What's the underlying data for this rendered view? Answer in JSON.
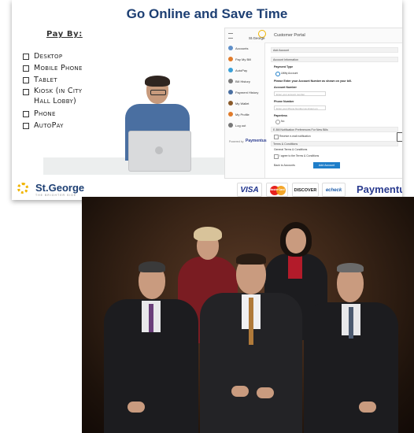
{
  "slide": {
    "title": "Go Online and Save Time",
    "pay_by_label": "Pay By:",
    "pay_methods": [
      "Desktop",
      "Mobile Phone",
      "Tablet",
      "Kiosk (in City",
      "Hall Lobby)",
      "Phone",
      "AutoPay"
    ],
    "portal": {
      "logo_text": "St.George",
      "header": "Customer Portal",
      "sidebar": [
        {
          "label": "Accounts",
          "icon": "accounts-icon",
          "color": "#5f8fc8"
        },
        {
          "label": "Pay My Bill",
          "icon": "pay-bill-icon",
          "color": "#e07b2a"
        },
        {
          "label": "AutoPay",
          "icon": "autopay-icon",
          "color": "#3aa0d8"
        },
        {
          "label": "Bill History",
          "icon": "bill-history-icon",
          "color": "#7a7a7a"
        },
        {
          "label": "Payment History",
          "icon": "payment-history-icon",
          "color": "#4a6fa1"
        },
        {
          "label": "My Wallet",
          "icon": "wallet-icon",
          "color": "#8a5a2a"
        },
        {
          "label": "My Profile",
          "icon": "profile-icon",
          "color": "#e07b2a"
        },
        {
          "label": "Log out",
          "icon": "logout-icon",
          "color": "#777777"
        }
      ],
      "powered_by": "Powered by",
      "powered_brand": "Paymentus",
      "form": {
        "add_account": "Add Account",
        "account_information": "Account Information",
        "payment_type": "Payment Type",
        "utility_account": "Utility Account",
        "enter_number_note": "Please Enter your Account Number as shown on your bill.",
        "account_number_label": "Account Number",
        "account_number_placeholder": "Enter your account number",
        "phone_number_label": "Phone Number",
        "phone_number_placeholder": "Enter your Phone Number as shown on",
        "paperless_label": "Paperless",
        "paperless_value": "No",
        "notification_pref": "E-Bill Notification Preferences For New Bills",
        "receive_email": "Receive e-mail notification",
        "terms_header": "Terms & Conditions",
        "general_terms": "General Terms & Conditions",
        "agree_terms": "I agree to the Terms & Conditions",
        "back_link": "Back to Accounts",
        "add_button": "Add Account"
      }
    },
    "brand": {
      "name": "St.George",
      "tagline": "THE BRIGHTER SIDE"
    },
    "payment_logos": {
      "visa": "VISA",
      "mastercard": "MasterCard",
      "discover": "DISCOVER",
      "echeck": "echeck",
      "paymentus": "Paymentus"
    }
  },
  "colors": {
    "title_blue": "#1d3f73",
    "brand_yellow": "#f0b400",
    "paymentus_blue": "#2a3b8f",
    "photo_background": "#3a2517",
    "suit_dark": "#1c1c1f"
  }
}
